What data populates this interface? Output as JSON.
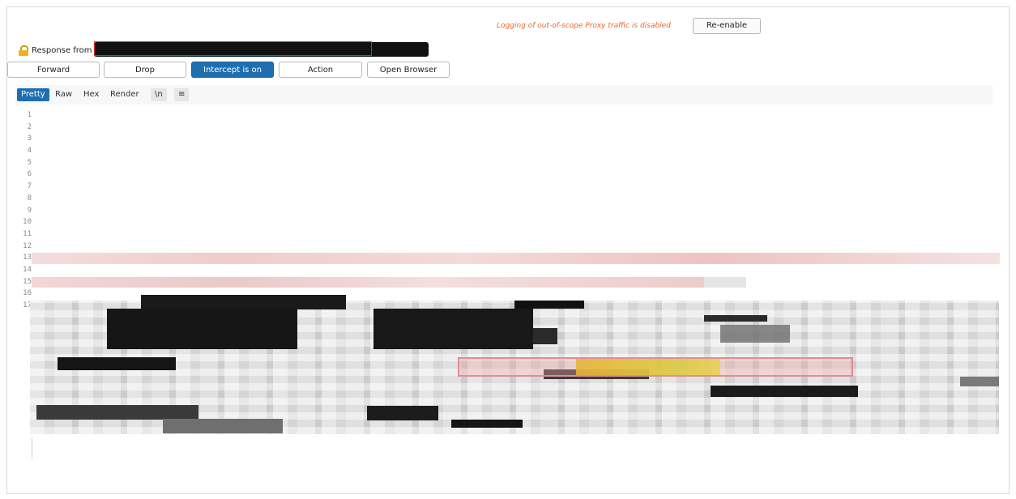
{
  "header": {
    "logging_message": "Logging of out-of-scope Proxy traffic is disabled",
    "reenable_label": "Re-enable"
  },
  "response": {
    "label": "Response from"
  },
  "toolbar": {
    "forward": "Forward",
    "drop": "Drop",
    "intercept": "Intercept is on",
    "action": "Action",
    "open_browser": "Open Browser"
  },
  "tabs": {
    "pretty": "Pretty",
    "raw": "Raw",
    "hex": "Hex",
    "render": "Render",
    "newline": "\\n",
    "menu": "≡"
  },
  "editor": {
    "line_numbers": [
      "1",
      "2",
      "3",
      "4",
      "5",
      "6",
      "7",
      "8",
      "9",
      "10",
      "11",
      "12",
      "13",
      "14",
      "15",
      "16",
      "17"
    ]
  },
  "colors": {
    "accent": "#1f6fb0",
    "warning_text": "#e8672d",
    "highlight_red": "#e9a4a4",
    "highlight_yellow": "#e2c33a"
  }
}
